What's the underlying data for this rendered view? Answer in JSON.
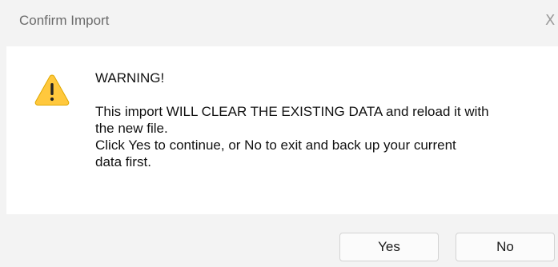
{
  "window": {
    "title": "Confirm Import",
    "close_glyph": "X"
  },
  "message": {
    "icon": "warning-icon",
    "heading": "WARNING!",
    "lines": [
      "This import WILL CLEAR THE EXISTING DATA and reload it with",
      "the new file.",
      "Click Yes to continue, or No to exit and back up your current",
      "data first."
    ]
  },
  "buttons": {
    "yes": "Yes",
    "no": "No"
  },
  "colors": {
    "warning_fill": "#FFC83D",
    "warning_glyph": "#222222"
  }
}
